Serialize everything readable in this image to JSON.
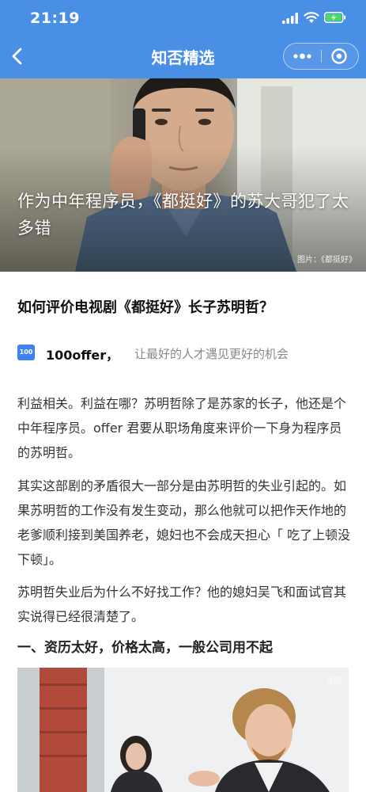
{
  "status_bar": {
    "time": "21:19"
  },
  "nav": {
    "title": "知否精选"
  },
  "hero": {
    "title": "作为中年程序员，《都挺好》的苏大哥犯了太多错",
    "credit": "图片：《都挺好》"
  },
  "article": {
    "question": "如何评价电视剧《都挺好》长子苏明哲？",
    "author": {
      "logo_text": "100",
      "name": "100offer，",
      "tagline": "让最好的人才遇见更好的机会"
    },
    "paragraphs": [
      "利益相关。利益在哪？苏明哲除了是苏家的长子，他还是个中年程序员。offer 君要从职场角度来评价一下身为程序员的苏明哲。",
      "其实这部剧的矛盾很大一部分是由苏明哲的失业引起的。如果苏明哲的工作没有发生变动，那么他就可以把作天作地的老爹顺利接到美国养老，媳妇也不会成天担心「 吃了上顿没下顿」。",
      "苏明哲失业后为什么不好找工作？他的媳妇吴飞和面试官其实说得已经很清楚了。"
    ],
    "subheading": "一、资历太好，价格太高，一般公司用不起",
    "image_watermark": "优酷"
  },
  "colors": {
    "nav_bg": "#4a8fe6",
    "battery_fill": "#4cd964",
    "logo_bg": "#3d82f0"
  }
}
